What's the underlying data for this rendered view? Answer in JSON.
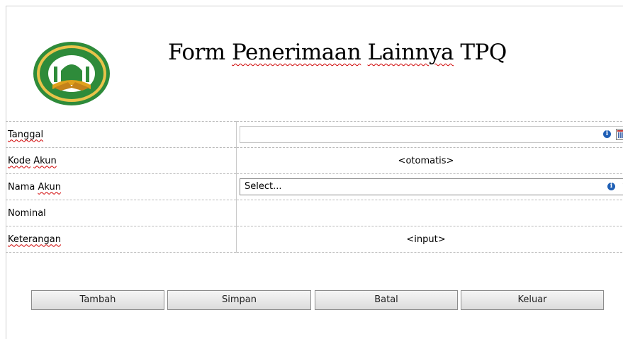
{
  "header": {
    "title_part1": "Form ",
    "title_part2": "Penerimaan",
    "title_part3": " ",
    "title_part4": "Lainnya",
    "title_part5": " TPQ"
  },
  "form": {
    "tanggal_label": "Tanggal",
    "tanggal_value": "",
    "kode_akun_label": "Kode Akun",
    "kode_akun_value": "<otomatis>",
    "nama_akun_label": "Nama Akun",
    "nama_akun_value": "Select...",
    "nominal_label": "Nominal",
    "nominal_value": "",
    "keterangan_label": "Keterangan",
    "keterangan_value": "<input>"
  },
  "buttons": {
    "tambah": "Tambah",
    "simpan": "Simpan",
    "batal": "Batal",
    "keluar": "Keluar"
  },
  "icons": {
    "info": "info-icon",
    "calendar": "calendar-icon",
    "dropdown": "chevron-down-icon",
    "logo": "mosque-logo"
  },
  "colors": {
    "logo_green": "#2e8b3a",
    "logo_gold": "#e0a21c",
    "info_blue": "#1f5fb5"
  }
}
